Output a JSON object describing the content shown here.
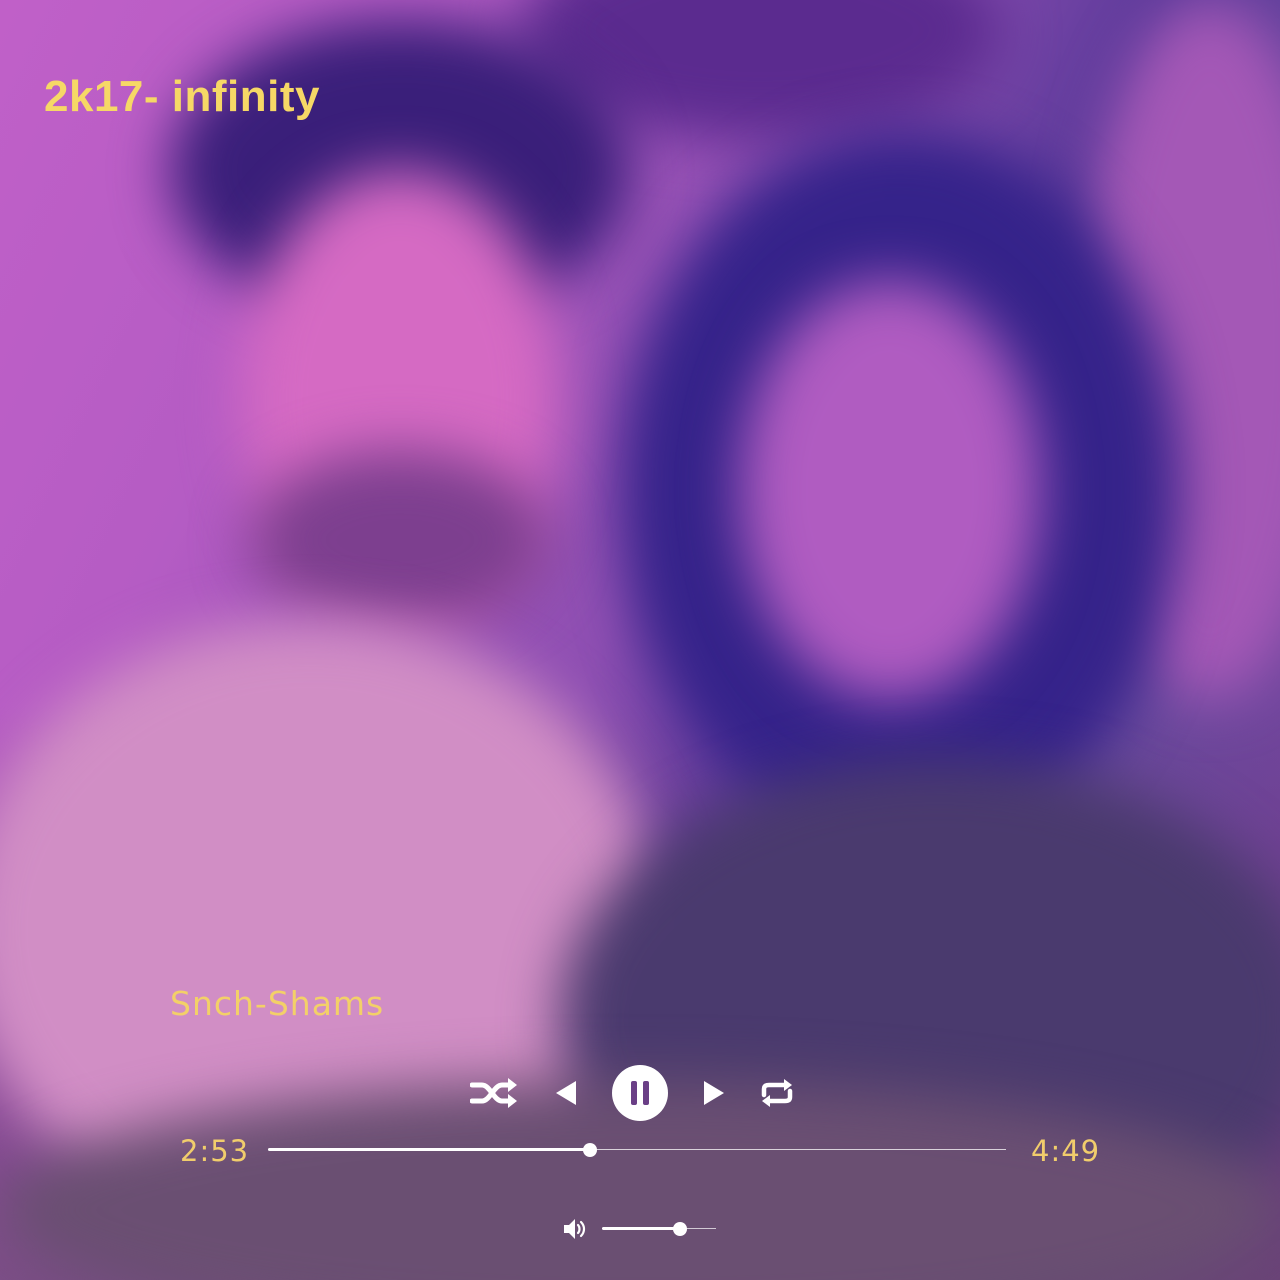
{
  "player": {
    "title": "2k17- infinity",
    "artist": "Snch-Shams",
    "artwork": "blurred-photo-of-two-people",
    "accent_color": "#f6d866",
    "control_color": "#ffffff"
  },
  "controls": {
    "shuffle_icon": "shuffle-icon",
    "previous_icon": "previous-icon",
    "play_state_icon": "pause-icon",
    "next_icon": "next-icon",
    "repeat_icon": "repeat-icon"
  },
  "progress": {
    "current_time": "2:53",
    "total_time": "4:49",
    "fraction": 0.436
  },
  "volume": {
    "icon": "volume-icon",
    "level": 0.68
  }
}
